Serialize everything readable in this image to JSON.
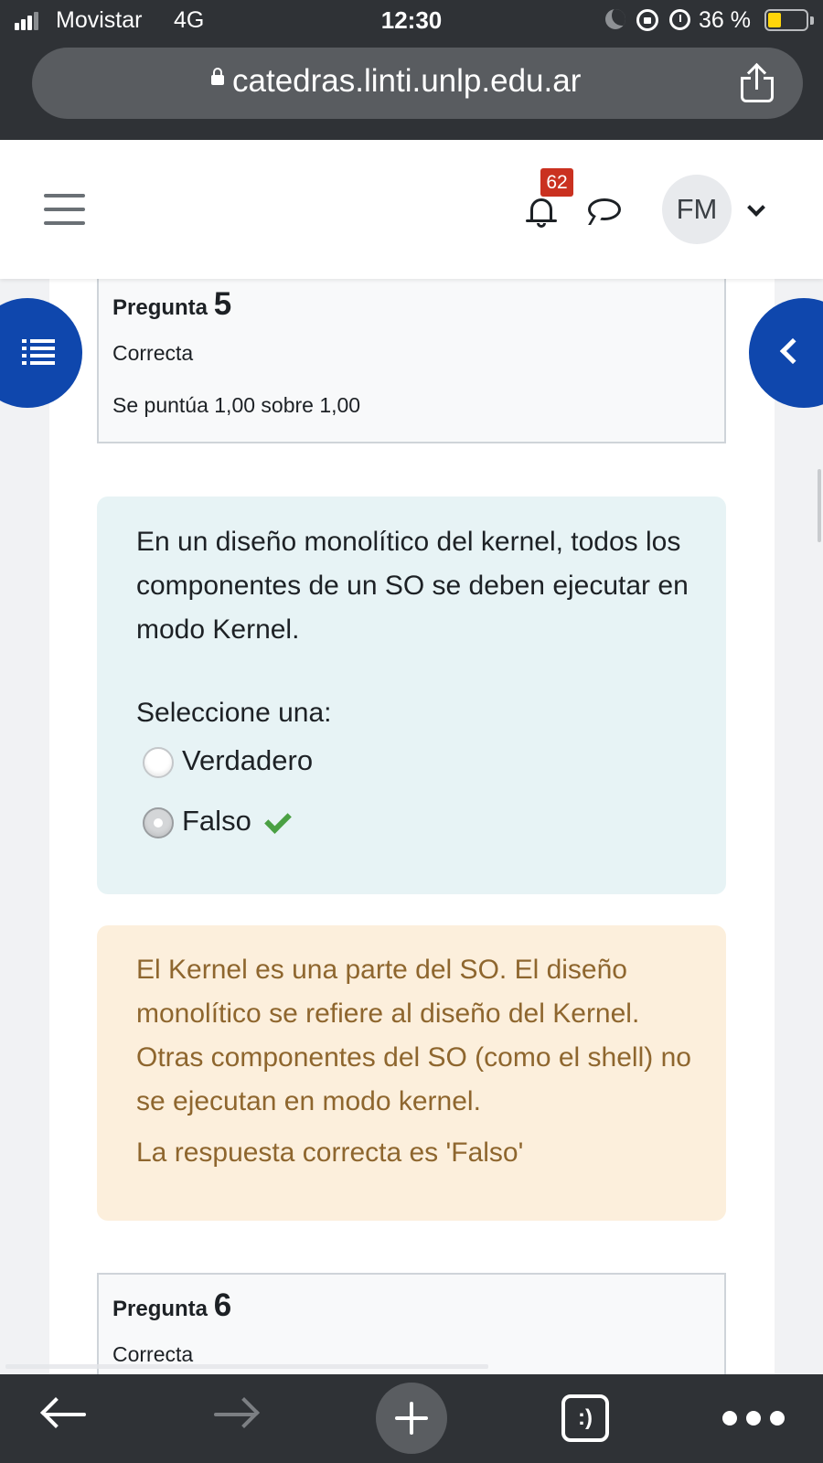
{
  "status_bar": {
    "carrier": "Movistar",
    "network": "4G",
    "time": "12:30",
    "battery_percent": "36 %",
    "battery_level": 0.36,
    "icons": [
      "signal-icon",
      "moon-icon",
      "rotation-lock-icon",
      "alarm-icon",
      "battery-icon"
    ]
  },
  "browser": {
    "url": "catedras.linti.unlp.edu.ar",
    "icons": [
      "lock-icon",
      "share-icon"
    ]
  },
  "navbar": {
    "notification_count": "62",
    "avatar_initials": "FM",
    "icons": [
      "menu-icon",
      "bell-icon",
      "chat-icon",
      "chevron-down-icon"
    ]
  },
  "question5": {
    "label": "Pregunta",
    "number": "5",
    "state": "Correcta",
    "grade": "Se puntúa 1,00 sobre 1,00"
  },
  "formulation": {
    "text": "En un diseño monolítico del kernel, todos los componentes de un SO se deben ejecutar en modo Kernel.",
    "prompt": "Seleccione una:",
    "options": [
      {
        "label": "Verdadero",
        "selected": false
      },
      {
        "label": "Falso",
        "selected": true,
        "correct": true
      }
    ]
  },
  "feedback": {
    "text": "El Kernel es una parte del SO. El diseño monolítico se refiere al diseño del Kernel. Otras componentes del SO (como el shell) no se ejecutan en modo kernel.",
    "right_answer": "La respuesta correcta es 'Falso'"
  },
  "question6": {
    "label": "Pregunta",
    "number": "6",
    "state": "Correcta"
  },
  "toolbar": {
    "tabs_label": ":)",
    "icons": [
      "back-arrow-icon",
      "forward-arrow-icon",
      "plus-icon",
      "tabs-icon",
      "more-icon"
    ]
  },
  "colors": {
    "primary_blue": "#0f47ad",
    "info_bg": "#e7f3f5",
    "feedback_bg": "#fcefdc",
    "feedback_text": "#8e662e",
    "badge_red": "#ca3120",
    "correct_green": "#4aa043"
  }
}
